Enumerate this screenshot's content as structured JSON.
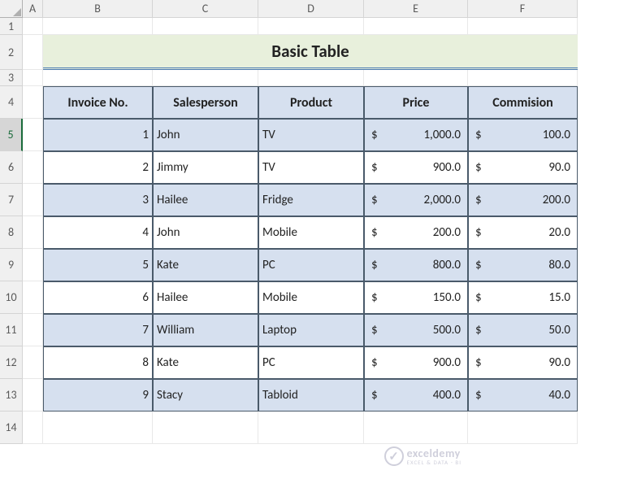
{
  "columns": [
    "A",
    "B",
    "C",
    "D",
    "E",
    "F"
  ],
  "row_numbers": [
    "1",
    "2",
    "3",
    "4",
    "5",
    "6",
    "7",
    "8",
    "9",
    "10",
    "11",
    "12",
    "13",
    "14"
  ],
  "selected_row": "5",
  "title": "Basic Table",
  "headers": [
    "Invoice No.",
    "Salesperson",
    "Product",
    "Price",
    "Commision"
  ],
  "rows": [
    {
      "invoice": "1",
      "salesperson": "John",
      "product": "TV",
      "price": "1,000.0",
      "commission": "100.0"
    },
    {
      "invoice": "2",
      "salesperson": "Jimmy",
      "product": "TV",
      "price": "900.0",
      "commission": "90.0"
    },
    {
      "invoice": "3",
      "salesperson": "Hailee",
      "product": "Fridge",
      "price": "2,000.0",
      "commission": "200.0"
    },
    {
      "invoice": "4",
      "salesperson": "John",
      "product": "Mobile",
      "price": "200.0",
      "commission": "20.0"
    },
    {
      "invoice": "5",
      "salesperson": "Kate",
      "product": "PC",
      "price": "800.0",
      "commission": "80.0"
    },
    {
      "invoice": "6",
      "salesperson": "Hailee",
      "product": "Mobile",
      "price": "150.0",
      "commission": "15.0"
    },
    {
      "invoice": "7",
      "salesperson": "William",
      "product": "Laptop",
      "price": "500.0",
      "commission": "50.0"
    },
    {
      "invoice": "8",
      "salesperson": "Kate",
      "product": "PC",
      "price": "900.0",
      "commission": "90.0"
    },
    {
      "invoice": "9",
      "salesperson": "Stacy",
      "product": "Tabloid",
      "price": "400.0",
      "commission": "40.0"
    }
  ],
  "currency_symbol": "$",
  "watermark": {
    "brand": "exceldemy",
    "tag": "EXCEL & DATA - BI"
  }
}
